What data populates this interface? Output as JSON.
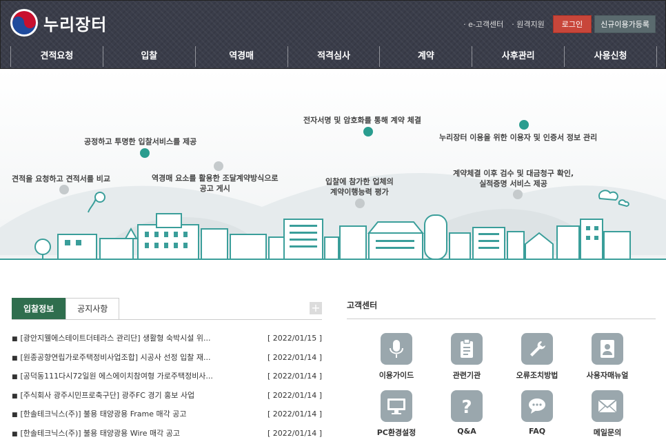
{
  "header": {
    "logo_text": "누리장터",
    "util_links": [
      "· e-고객센터",
      "· 원격지원"
    ],
    "login_label": "로그인",
    "signup_label": "신규이용가등록"
  },
  "nav": [
    "견적요청",
    "입찰",
    "역경매",
    "적격심사",
    "계약",
    "사후관리",
    "사용신청"
  ],
  "visual": {
    "items": [
      {
        "text": "견적을 요청하고 견적서를 비교"
      },
      {
        "text": "공정하고 투명한 입찰서비스를 제공"
      },
      {
        "text": "역경매 요소를 활용한 조달계약방식으로\n공고 게시"
      },
      {
        "text": "전자서명 및 암호화를 통해 계약 체결"
      },
      {
        "text": "입찰에 참가한 업체의\n계약이행능력 평가"
      },
      {
        "text": "누리장터 이용을 위한 이용자 및 인증서 정보 관리"
      },
      {
        "text": "계약체결 이후 검수 및 대금청구 확인,\n실적증명 서비스 제공"
      }
    ]
  },
  "board": {
    "tabs": [
      "입찰정보",
      "공지사항"
    ],
    "plus": "+",
    "items": [
      {
        "title": "[광안지웰에스테이트더테라스 관리단] 생활형 숙박시설 위...",
        "date": "[ 2022/01/15 ]"
      },
      {
        "title": "[원종공향연립가로주택정비사업조합] 시공사 선정 입찰 재...",
        "date": "[ 2022/01/14 ]"
      },
      {
        "title": "[공덕동111다시72일원 에스에이치참여형 가로주택정비사...",
        "date": "[ 2022/01/14 ]"
      },
      {
        "title": "[주식회사 광주시민프로축구단] 광주FC 경기 홍보 사업",
        "date": "[ 2022/01/14 ]"
      },
      {
        "title": "[한솔테크닉스(주)] 불용 태양광용 Frame 매각 공고",
        "date": "[ 2022/01/14 ]"
      },
      {
        "title": "[한솔테크닉스(주)] 불용 태양광용 Wire 매각 공고",
        "date": "[ 2022/01/14 ]"
      }
    ]
  },
  "customer_center": {
    "title": "고객센터",
    "items": [
      {
        "label": "이용가이드",
        "icon": "microphone-icon"
      },
      {
        "label": "관련기관",
        "icon": "clipboard-icon"
      },
      {
        "label": "오류조치방법",
        "icon": "wrench-icon"
      },
      {
        "label": "사용자매뉴얼",
        "icon": "manual-icon"
      },
      {
        "label": "PC환경설정",
        "icon": "monitor-icon"
      },
      {
        "label": "Q&A",
        "icon": "question-icon"
      },
      {
        "label": "FAQ",
        "icon": "chat-icon"
      },
      {
        "label": "메일문의",
        "icon": "mail-icon"
      }
    ]
  },
  "colors": {
    "header_bg": "#3a3d4a",
    "login": "#c8463a",
    "accent_green": "#2f6e4e",
    "teal": "#2a9d8f"
  }
}
